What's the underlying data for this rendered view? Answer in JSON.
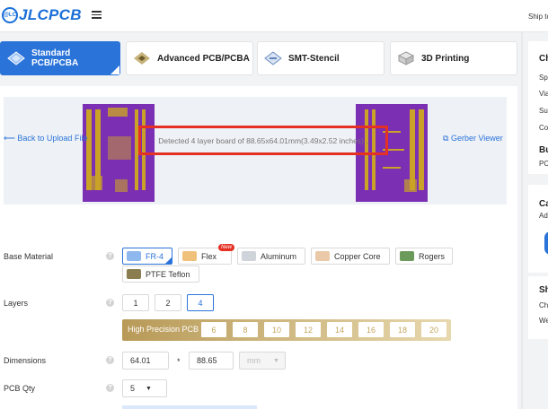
{
  "header": {
    "logo_badge": "@LC",
    "logo_text": "JLCPCB",
    "ship_to": "Ship to"
  },
  "tabs": [
    {
      "label": "Standard PCB/PCBA",
      "icon": "pcb-board-icon",
      "active": true
    },
    {
      "label": "Advanced PCB/PCBA",
      "icon": "chip-icon",
      "active": false
    },
    {
      "label": "SMT-Stencil",
      "icon": "stencil-icon",
      "active": false
    },
    {
      "label": "3D Printing",
      "icon": "3d-cube-icon",
      "active": false
    }
  ],
  "upload": {
    "back_link": "Back to Upload File",
    "detected": "Detected 4 layer board of 88.65x64.01mm(3.49x2.52 inches) .",
    "gerber_viewer": "Gerber Viewer"
  },
  "base_material": {
    "label": "Base Material",
    "options": [
      "FR-4",
      "Flex",
      "Aluminum",
      "Copper Core",
      "Rogers",
      "PTFE Teflon"
    ],
    "selected": "FR-4",
    "new_badge": "New"
  },
  "layers": {
    "label": "Layers",
    "options": [
      "1",
      "2",
      "4"
    ],
    "selected": "4",
    "high_precision_label": "High Precision PCB",
    "high_precision_options": [
      "6",
      "8",
      "10",
      "12",
      "14",
      "16",
      "18",
      "20"
    ]
  },
  "dimensions": {
    "label": "Dimensions",
    "width": "64.01",
    "times": "*",
    "height": "88.65",
    "unit": "mm"
  },
  "pcb_qty": {
    "label": "PCB Qty",
    "value": "5"
  },
  "right_panel": {
    "section1": [
      "Ch",
      "Sp",
      "Via",
      "Su",
      "Co"
    ],
    "section2": [
      "Bu",
      "PC"
    ],
    "section3": [
      "Ca",
      "Ad"
    ],
    "section4": [
      "Sh",
      "Ch",
      "We"
    ]
  },
  "colors": {
    "accent": "#2a73d9",
    "highlight_box": "#e53024",
    "board": "#7b2fb3",
    "gold": "#c5a75e"
  }
}
